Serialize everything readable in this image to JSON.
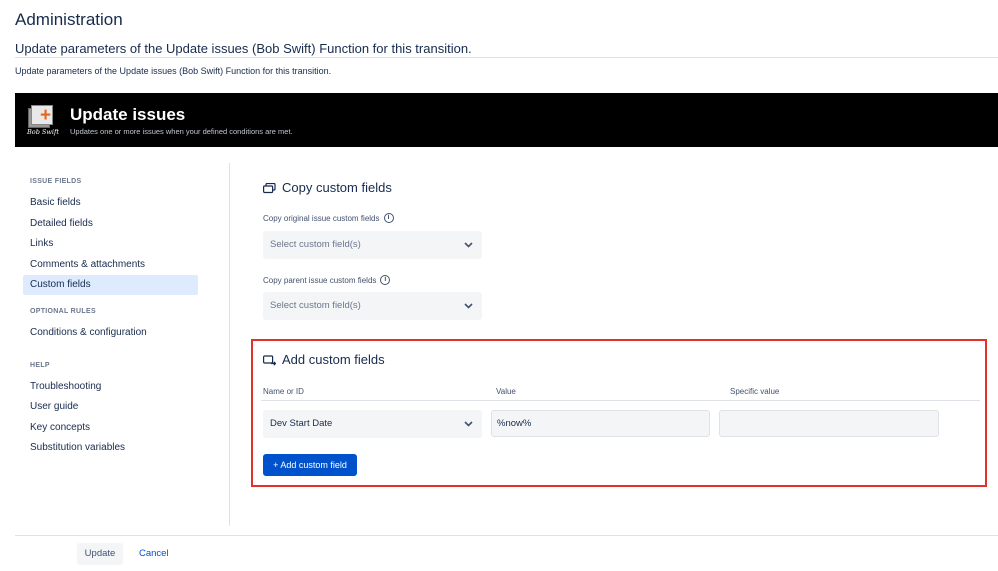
{
  "page": {
    "title": "Administration",
    "heading": "Update parameters of the Update issues (Bob Swift) Function for this transition.",
    "description": "Update parameters of the Update issues (Bob Swift) Function for this transition."
  },
  "banner": {
    "logo_text": "Bob Swift",
    "title": "Update issues",
    "subtitle": "Updates one or more issues when your defined conditions are met."
  },
  "sidebar": {
    "sections": [
      {
        "heading": "ISSUE FIELDS",
        "items": [
          "Basic fields",
          "Detailed fields",
          "Links",
          "Comments & attachments",
          "Custom fields"
        ]
      },
      {
        "heading": "OPTIONAL RULES",
        "items": [
          "Conditions & configuration"
        ]
      },
      {
        "heading": "HELP",
        "items": [
          "Troubleshooting",
          "User guide",
          "Key concepts",
          "Substitution variables"
        ]
      }
    ],
    "active_item": "Custom fields"
  },
  "copy_section": {
    "title": "Copy custom fields",
    "original_label": "Copy original issue custom fields",
    "original_placeholder": "Select custom field(s)",
    "parent_label": "Copy parent issue custom fields",
    "parent_placeholder": "Select custom field(s)"
  },
  "add_section": {
    "title": "Add custom fields",
    "columns": [
      "Name or ID",
      "Value",
      "Specific value"
    ],
    "row": {
      "name": "Dev Start Date",
      "value": "%now%",
      "specific_value": ""
    },
    "add_button": "+ Add custom field"
  },
  "footer": {
    "update_label": "Update",
    "cancel_label": "Cancel"
  },
  "colors": {
    "primary": "#0052cc",
    "highlight_border": "#e4302a",
    "banner_bg": "#000000",
    "active_nav_bg": "#deebff"
  }
}
